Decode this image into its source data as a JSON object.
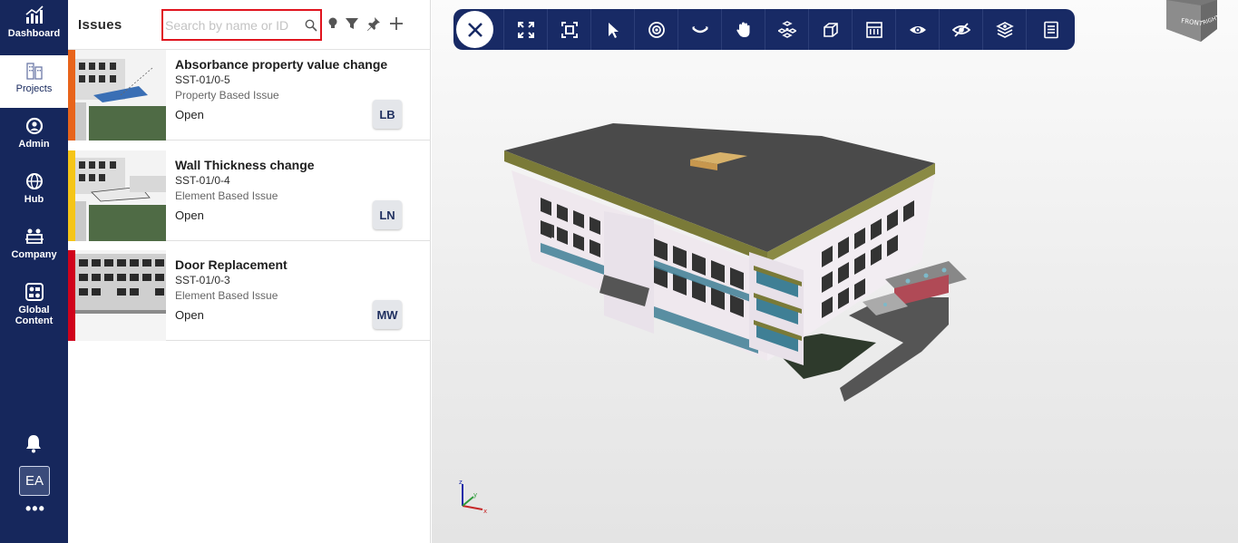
{
  "nav": {
    "items": [
      {
        "label": "Dashboard",
        "icon": "bar-chart-icon"
      },
      {
        "label": "Projects",
        "icon": "buildings-icon"
      },
      {
        "label": "Admin",
        "icon": "admin-gear-icon"
      },
      {
        "label": "Hub",
        "icon": "globe-icon"
      },
      {
        "label": "Company",
        "icon": "company-people-icon"
      },
      {
        "label": "Global Content",
        "icon": "global-content-icon"
      }
    ],
    "active": "Projects",
    "avatar": "EA",
    "more": "•••"
  },
  "issues": {
    "title": "Issues",
    "search_placeholder": "Search by name or ID",
    "list": [
      {
        "title": "Absorbance property value change",
        "id": "SST-01/0-5",
        "type": "Property Based Issue",
        "status": "Open",
        "assignee": "LB",
        "color": "#e8641b"
      },
      {
        "title": "Wall Thickness change",
        "id": "SST-01/0-4",
        "type": "Element Based Issue",
        "status": "Open",
        "assignee": "LN",
        "color": "#f5c518"
      },
      {
        "title": "Door Replacement",
        "id": "SST-01/0-3",
        "type": "Element Based Issue",
        "status": "Open",
        "assignee": "MW",
        "color": "#d0021b"
      }
    ]
  },
  "viewer": {
    "tools": [
      "fit-view-icon",
      "focus-frame-icon",
      "select-pointer-icon",
      "orbit-icon",
      "look-around-icon",
      "pan-hand-icon",
      "explode-icon",
      "section-box-icon",
      "section-plane-icon",
      "show-icon",
      "hide-icon",
      "layers-icon",
      "properties-icon"
    ],
    "nav_cube": {
      "front": "FRONT",
      "right": "RIGHT"
    },
    "axes": {
      "x": "x",
      "y": "y",
      "z": "z"
    }
  },
  "colors": {
    "rail": "#16275c",
    "toolbar": "#182a65",
    "search_border": "#e0141e"
  }
}
